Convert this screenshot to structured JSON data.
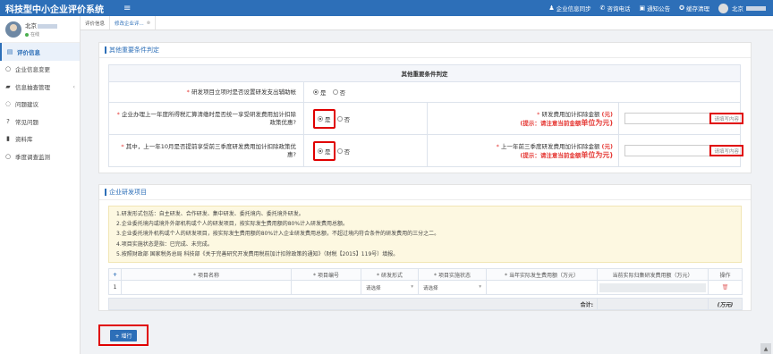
{
  "app": {
    "title": "科技型中小企业评价系统"
  },
  "topbar": {
    "items": [
      {
        "label": "企业信息同步",
        "icon": "user-sync-icon"
      },
      {
        "label": "咨询电话",
        "icon": "phone-icon"
      },
      {
        "label": "通知公告",
        "icon": "notice-icon"
      },
      {
        "label": "缓存清理",
        "icon": "clean-icon"
      }
    ],
    "user": "北京"
  },
  "sidebar": {
    "user_name": "北京",
    "user_status": "在线",
    "items": [
      {
        "label": "评价信息",
        "icon": "clipboard-icon",
        "active": true
      },
      {
        "label": "企业信息变更",
        "icon": "circle-icon"
      },
      {
        "label": "信息抽查管理",
        "icon": "folder-icon",
        "has_arrow": true
      },
      {
        "label": "问题建议",
        "icon": "chat-icon"
      },
      {
        "label": "常见问题",
        "icon": "question-icon"
      },
      {
        "label": "资料库",
        "icon": "book-icon"
      },
      {
        "label": "季度调查监测",
        "icon": "circle-icon"
      }
    ]
  },
  "tabs": [
    {
      "label": "评价信息"
    },
    {
      "label": "修改企业评..."
    }
  ],
  "section1": {
    "title": "其他重要条件判定",
    "table_header": "其他重要条件判定",
    "rows": [
      {
        "question": "研发项目立项时是否设置研发支出辅助帐",
        "yes": "是",
        "no": "否"
      },
      {
        "question": "企业办理上一年度所得税汇算清缴时是否统一享受研发费用加计扣除政策优惠?",
        "yes": "是",
        "no": "否",
        "amount_label": "研发费用加计扣除金额",
        "unit": "(元)",
        "hint": "(提示：请注意当前金额",
        "hint_bold": "单位为元)",
        "placeholder": "请填写内容"
      },
      {
        "question": "其中，上一年10月是否提前享受前三季度研发费用加计扣除政策优惠?",
        "yes": "是",
        "no": "否",
        "amount_label": "上一年前三季度研发费用加计扣除金额",
        "unit": "(元)",
        "hint": "(提示：请注意当前金额",
        "hint_bold": "单位为元)",
        "placeholder": "请填写内容"
      }
    ]
  },
  "section2": {
    "title": "企业研发项目",
    "notes": [
      "1.研发形式包括：自主研发、合作研发、集中研发、委托境内、委托境外研发。",
      "2.企业委托境内或境外外部机构或个人的研发项目，按实际发生费用额的80%计入研发费用总额。",
      "3.企业委托境外机构或个人的研发项目，按实际发生费用额的80%计入企业研发费用总额，不超过境内符合条件的研发费用的三分之二。",
      "4.项目实施状态是指：已完成、未完成。",
      "5.按照财政部 国家税务总局 科技部《关于完善研究开发费用税前加计扣除政策的通知》（财税【2015】119号）填报。"
    ],
    "columns": [
      "+",
      "* 项目名称",
      "* 项目编号",
      "* 研发形式",
      "* 项目实施状态",
      "* 当年实际发生费用额（万元）",
      "当前实际归集研发费用额（万元）",
      "操作"
    ],
    "row": {
      "index": "1",
      "form_select": "请选择",
      "status_select": "请选择",
      "delete_icon": "trash-icon"
    },
    "sum_label": "合计:",
    "sum_unit": "(万元)",
    "add_button": "+ 增行"
  }
}
